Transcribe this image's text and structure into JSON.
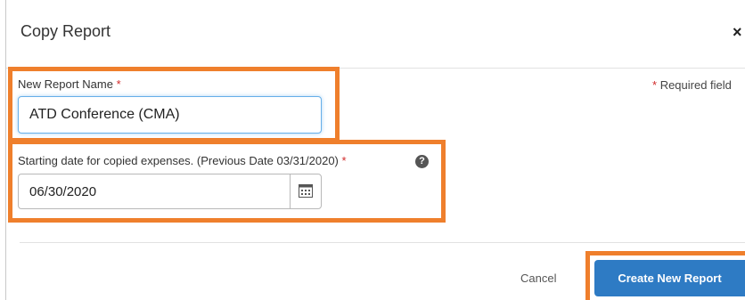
{
  "dialog": {
    "title": "Copy Report",
    "close": "×",
    "required_note": "Required field",
    "required_star": "*"
  },
  "form": {
    "report_name": {
      "label": "New Report Name",
      "value": "ATD Conference (CMA)"
    },
    "start_date": {
      "label": "Starting date for copied expenses. (Previous Date 03/31/2020)",
      "value": "06/30/2020",
      "help": "?"
    }
  },
  "footer": {
    "cancel": "Cancel",
    "submit": "Create New Report"
  },
  "colors": {
    "highlight": "#ef7f2c",
    "primary_button": "#2e7bc4",
    "required": "#d12a2a"
  },
  "icons": [
    "close-icon",
    "help-icon",
    "calendar-icon"
  ]
}
